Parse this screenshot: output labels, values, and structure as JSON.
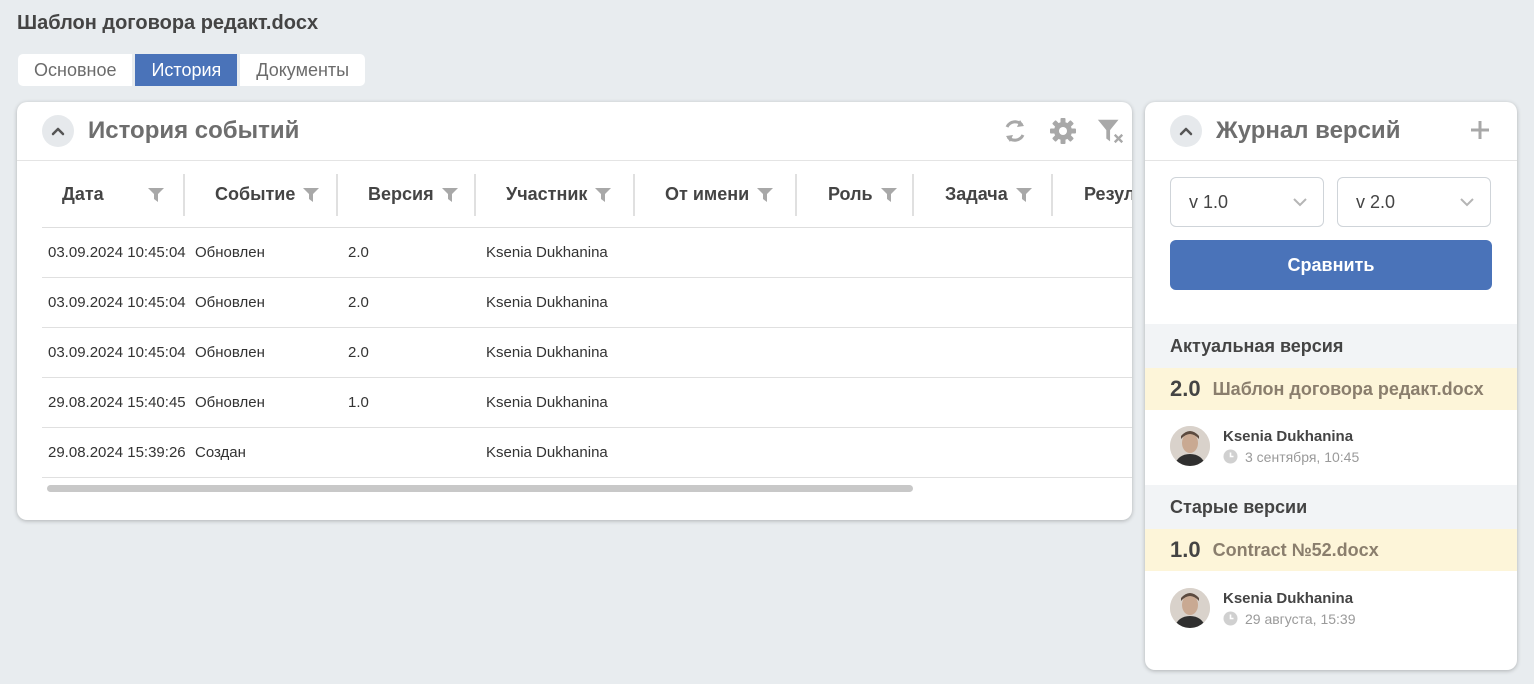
{
  "document": {
    "title": "Шаблон договора редакт.docx"
  },
  "tabs": [
    {
      "label": "Основное",
      "active": false
    },
    {
      "label": "История",
      "active": true
    },
    {
      "label": "Документы",
      "active": false
    }
  ],
  "history": {
    "title": "История событий",
    "columns": [
      "Дата",
      "Событие",
      "Версия",
      "Участник",
      "От имени",
      "Роль",
      "Задача",
      "Резул"
    ],
    "rows": [
      [
        "03.09.2024 10:45:04",
        "Обновлен",
        "2.0",
        "Ksenia Dukhanina",
        "",
        "",
        "",
        ""
      ],
      [
        "03.09.2024 10:45:04",
        "Обновлен",
        "2.0",
        "Ksenia Dukhanina",
        "",
        "",
        "",
        ""
      ],
      [
        "03.09.2024 10:45:04",
        "Обновлен",
        "2.0",
        "Ksenia Dukhanina",
        "",
        "",
        "",
        ""
      ],
      [
        "29.08.2024 15:40:45",
        "Обновлен",
        "1.0",
        "Ksenia Dukhanina",
        "",
        "",
        "",
        ""
      ],
      [
        "29.08.2024 15:39:26",
        "Создан",
        "",
        "Ksenia Dukhanina",
        "",
        "",
        "",
        ""
      ]
    ]
  },
  "versions": {
    "title": "Журнал версий",
    "select_left": "v 1.0",
    "select_right": "v 2.0",
    "compare_label": "Сравнить",
    "current_section": "Актуальная версия",
    "current": {
      "number": "2.0",
      "name": "Шаблон договора редакт.docx",
      "author": "Ksenia Dukhanina",
      "date": "3 сентября, 10:45"
    },
    "old_section": "Старые версии",
    "old": {
      "number": "1.0",
      "name": "Contract №52.docx",
      "author": "Ksenia Dukhanina",
      "date": "29 августа, 15:39"
    }
  },
  "colors": {
    "accent": "#4a73b9",
    "background": "#e8ecef",
    "highlight": "#fdf5d9"
  }
}
